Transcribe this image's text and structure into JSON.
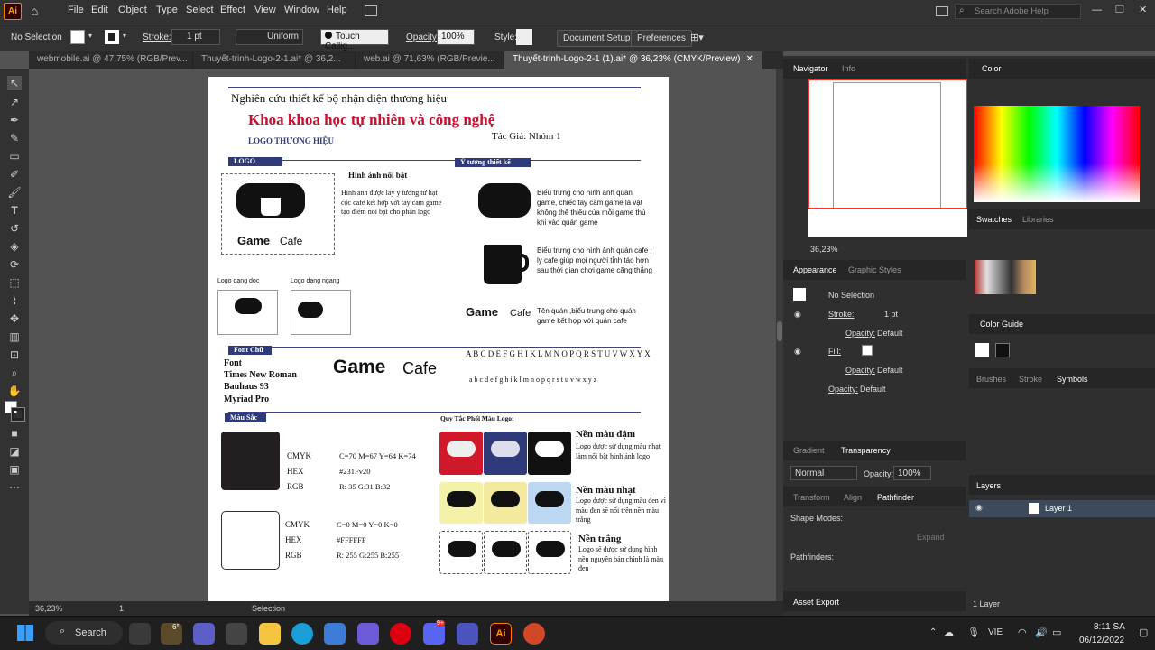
{
  "menubar": {
    "items": [
      "File",
      "Edit",
      "Object",
      "Type",
      "Select",
      "Effect",
      "View",
      "Window",
      "Help"
    ],
    "search_placeholder": "Search Adobe Help"
  },
  "control": {
    "selection": "No Selection",
    "stroke_label": "Stroke:",
    "stroke_value": "1 pt",
    "profile": "Uniform",
    "brush": "Touch Callig...",
    "opacity_label": "Opacity:",
    "opacity_value": "100%",
    "style_label": "Style:",
    "doc_setup": "Document Setup",
    "preferences": "Preferences"
  },
  "tabs": [
    {
      "label": "webmobile.ai @ 47,75% (RGB/Prev...",
      "active": false
    },
    {
      "label": "Thuyết-trinh-Logo-2-1.ai* @ 36,2...",
      "active": false
    },
    {
      "label": "web.ai @ 71,63% (RGB/Previe...",
      "active": false
    },
    {
      "label": "Thuyết-trinh-Logo-2-1 (1).ai* @ 36,23% (CMYK/Preview)",
      "active": true
    }
  ],
  "doc": {
    "header": "Nghiên cứu thiết kế bộ nhận diện thương hiệu",
    "title": "Khoa khoa học tự nhiên và công nghệ",
    "subtitle": "LOGO THƯƠNG HIỆU",
    "author": "Tác Giả: Nhóm 1",
    "sec_logo": "LOGO",
    "sec_idea": "Ý tưởng thiết kế",
    "image_title": "Hình ảnh nổi bật",
    "image_desc": "Hình ảnh được lấy ý tưởng từ hạt cốc cafe kết hợp với tay cầm game tạo điểm nổi bật cho phần logo",
    "game_word": "Game",
    "cafe_word": "Cafe",
    "logo_vertical": "Logo dạng dọc",
    "logo_horizontal": "Logo dạng ngang",
    "idea1": "Biểu trưng cho hình ảnh quán game, chiếc tay cầm game là vật không thể thiếu của mỗi game thủ khi vào quán game",
    "idea2": "Biểu trưng cho hình ảnh quán cafe , ly cafe giúp mọi người tỉnh táo hơn sau thời gian chơi game căng thẳng",
    "idea3": "Tên quán ,biểu trưng cho quán game kết hợp với quán cafe",
    "sec_font": "Font Chữ",
    "font_label": "Font",
    "font1": "Times New Roman",
    "font2": "Bauhaus 93",
    "font3": "Myriad Pro",
    "alpha_upper": "A B C D E F G H I K L M N O P Q R S T U V W X Y X",
    "alpha_lower": "a b c d e f g h i k l m n o p q r s t u v w x y z",
    "sec_color": "Màu Sắc",
    "rules_title": "Quy Tắc Phối Màu Logo:",
    "dark_cmyk_lbl": "CMYK",
    "dark_cmyk": "C=70 M=67 Y=64 K=74",
    "dark_hex_lbl": "HEX",
    "dark_hex": "#231Fv20",
    "dark_rgb_lbl": "RGB",
    "dark_rgb": "R: 35 G:31 B:32",
    "light_cmyk_lbl": "CMYK",
    "light_cmyk": "C=0 M=0 Y=0 K=0",
    "light_hex_lbl": "HEX",
    "light_hex": "#FFFFFF",
    "light_rgb_lbl": "RGB",
    "light_rgb": "R: 255 G:255 B:255",
    "bg_dark_title": "Nền màu đậm",
    "bg_dark_desc": "Logo được sử dụng màu nhạt làm nổi bật hình ảnh logo",
    "bg_light_title": "Nền màu nhạt",
    "bg_light_desc": "Logo được sử dụng màu đen vì màu đen sẽ nổi trên nền màu trắng",
    "bg_white_title": "Nền trắng",
    "bg_white_desc": "Logo sẽ được sử dụng hình nền nguyên bản chính là màu đen",
    "dark_color": "#231F20",
    "light_color": "#FFFFFF"
  },
  "status": {
    "zoom": "36,23%",
    "page": "1",
    "tool": "Selection"
  },
  "panels": {
    "navigator_tab": "Navigator",
    "info_tab": "Info",
    "nav_zoom": "36,23%",
    "color_tab": "Color",
    "swatches_tab": "Swatches",
    "libraries_tab": "Libraries",
    "appearance_tab": "Appearance",
    "graphic_styles_tab": "Graphic Styles",
    "no_selection": "No Selection",
    "stroke_lbl": "Stroke:",
    "stroke_val": "1 pt",
    "opacity_lbl": "Opacity:",
    "opacity_default": "Default",
    "fill_lbl": "Fill:",
    "color_guide_tab": "Color Guide",
    "brushes_tab": "Brushes",
    "stroke_tab": "Stroke",
    "symbols_tab": "Symbols",
    "gradient_tab": "Gradient",
    "transparency_tab": "Transparency",
    "blend_mode": "Normal",
    "trans_opacity_lbl": "Opacity:",
    "trans_opacity": "100%",
    "transform_tab": "Transform",
    "align_tab": "Align",
    "pathfinder_tab": "Pathfinder",
    "shape_modes": "Shape Modes:",
    "expand": "Expand",
    "pathfinders": "Pathfinders:",
    "asset_export_tab": "Asset Export",
    "layers_tab": "Layers",
    "layer1": "Layer 1",
    "layer_count": "1 Layer"
  },
  "taskbar": {
    "search": "Search",
    "temp": "6°",
    "lang": "VIE",
    "time": "8:11 SA",
    "date": "06/12/2022",
    "badge": "9+"
  }
}
